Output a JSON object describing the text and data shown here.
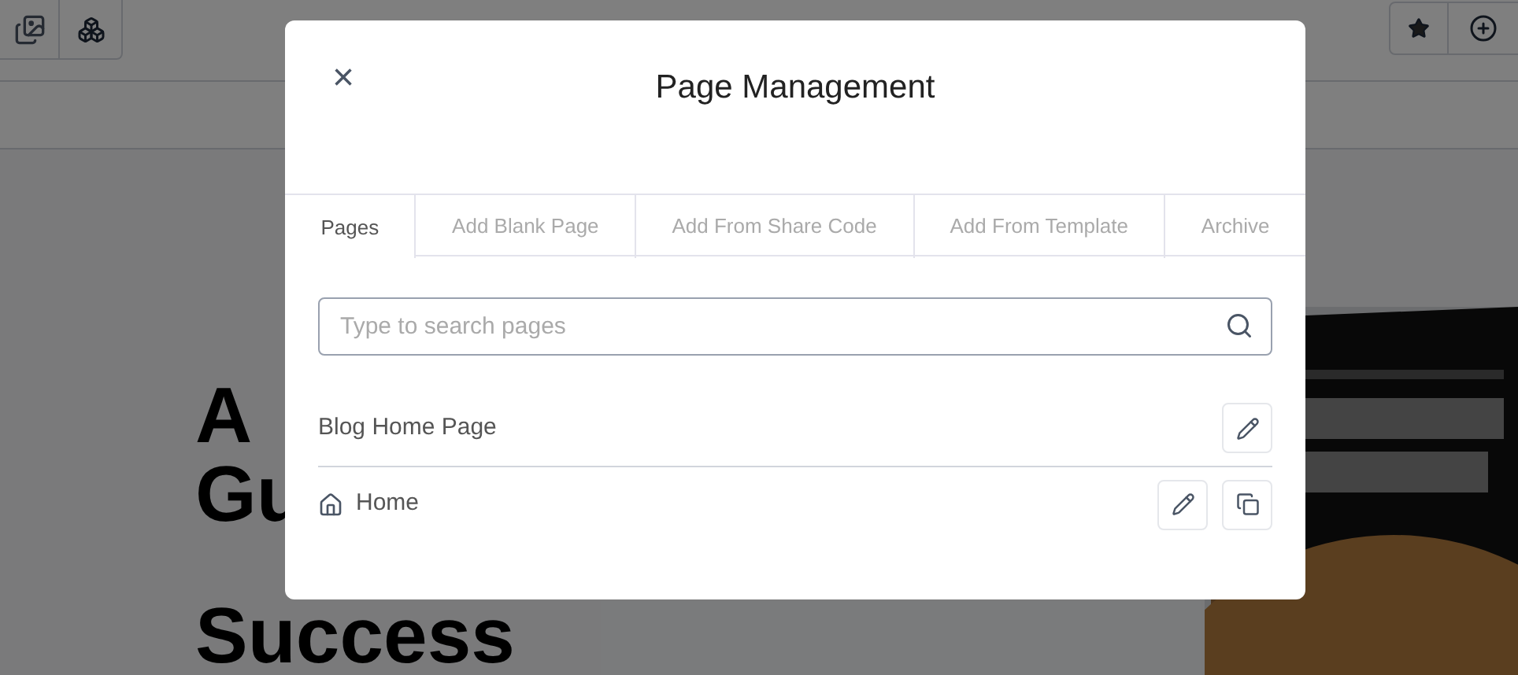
{
  "background": {
    "headline_lines": [
      "A",
      "Gu",
      "Success"
    ]
  },
  "modal": {
    "close": "×",
    "title": "Page Management",
    "tabs": [
      {
        "label": "Pages",
        "selected": true
      },
      {
        "label": "Add Blank Page",
        "selected": false
      },
      {
        "label": "Add From Share Code",
        "selected": false
      },
      {
        "label": "Add From Template",
        "selected": false
      },
      {
        "label": "Archive",
        "selected": false
      }
    ],
    "search": {
      "placeholder": "Type to search pages"
    },
    "pages": [
      {
        "name": "Blog Home Page",
        "home": false,
        "duplicable": false
      },
      {
        "name": "Home",
        "home": true,
        "duplicable": true
      }
    ]
  }
}
